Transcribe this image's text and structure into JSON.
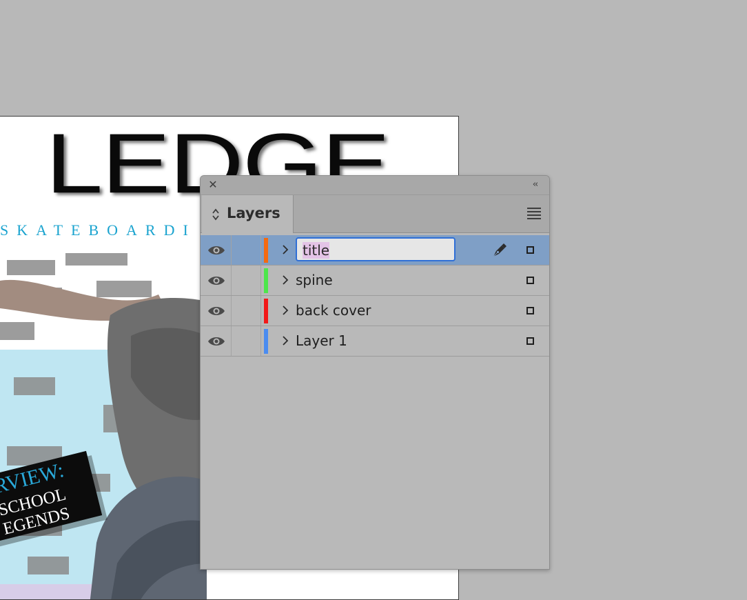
{
  "document": {
    "masthead": "LEDGE",
    "subhead": "SKATEBOARDI",
    "banner": {
      "line1": "ERVIEW:",
      "line2": "SCHOOL",
      "line3": "EGENDS"
    }
  },
  "panel": {
    "tab_label": "Layers",
    "icons": {
      "close": "close-icon",
      "collapse": "double-chevron-left-icon",
      "menu": "hamburger-menu-icon",
      "sort": "up-down-arrows-icon"
    },
    "layers": [
      {
        "name": "title",
        "color": "#f46a0f",
        "selected": true,
        "editing": true,
        "visible": true
      },
      {
        "name": "spine",
        "color": "#4de64b",
        "selected": false,
        "editing": false,
        "visible": true
      },
      {
        "name": "back cover",
        "color": "#f21818",
        "selected": false,
        "editing": false,
        "visible": true
      },
      {
        "name": "Layer 1",
        "color": "#4a8cf0",
        "selected": false,
        "editing": false,
        "visible": true
      }
    ]
  },
  "colors": {
    "canvas_background": "#b8b8b8",
    "panel_background": "#b9b9b9",
    "selection": "#7f9fc6",
    "input_focus": "#2f6fd6",
    "accent_cyan": "#1aa3cf"
  }
}
